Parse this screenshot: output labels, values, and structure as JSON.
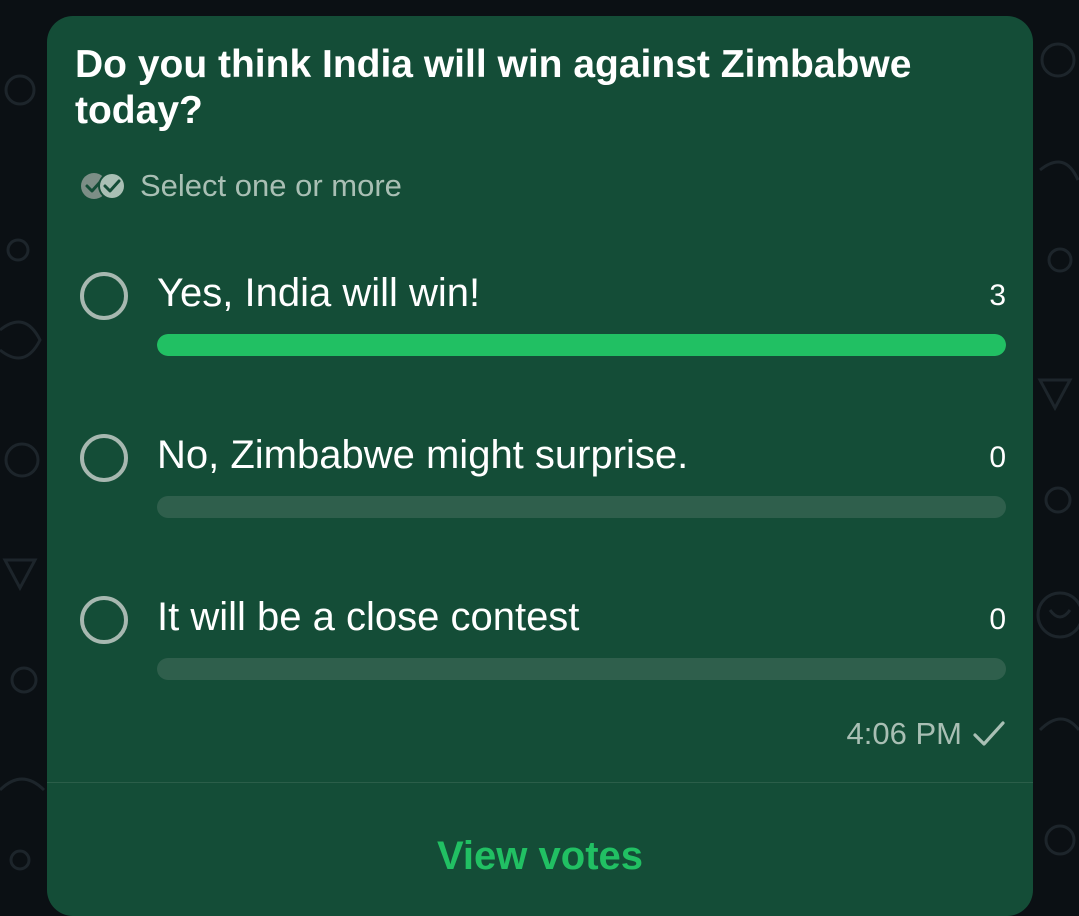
{
  "poll": {
    "question": "Do you think India will win against Zimbabwe today?",
    "hint": "Select one or more",
    "hint_icon": "double-check-circles-icon",
    "options": [
      {
        "label": "Yes, India will win!",
        "count": "3",
        "share": 1.0
      },
      {
        "label": "No, Zimbabwe might surprise.",
        "count": "0",
        "share": 0
      },
      {
        "label": "It will be a close contest",
        "count": "0",
        "share": 0
      }
    ],
    "time": "4:06 PM",
    "status_icon": "single-check-icon",
    "view_votes": "View votes"
  },
  "colors": {
    "bubble": "#144d37",
    "accent": "#21c063",
    "track": "#2f5f4c",
    "muted_text": "#a9bfb4",
    "wallpaper": "#0b1014"
  }
}
